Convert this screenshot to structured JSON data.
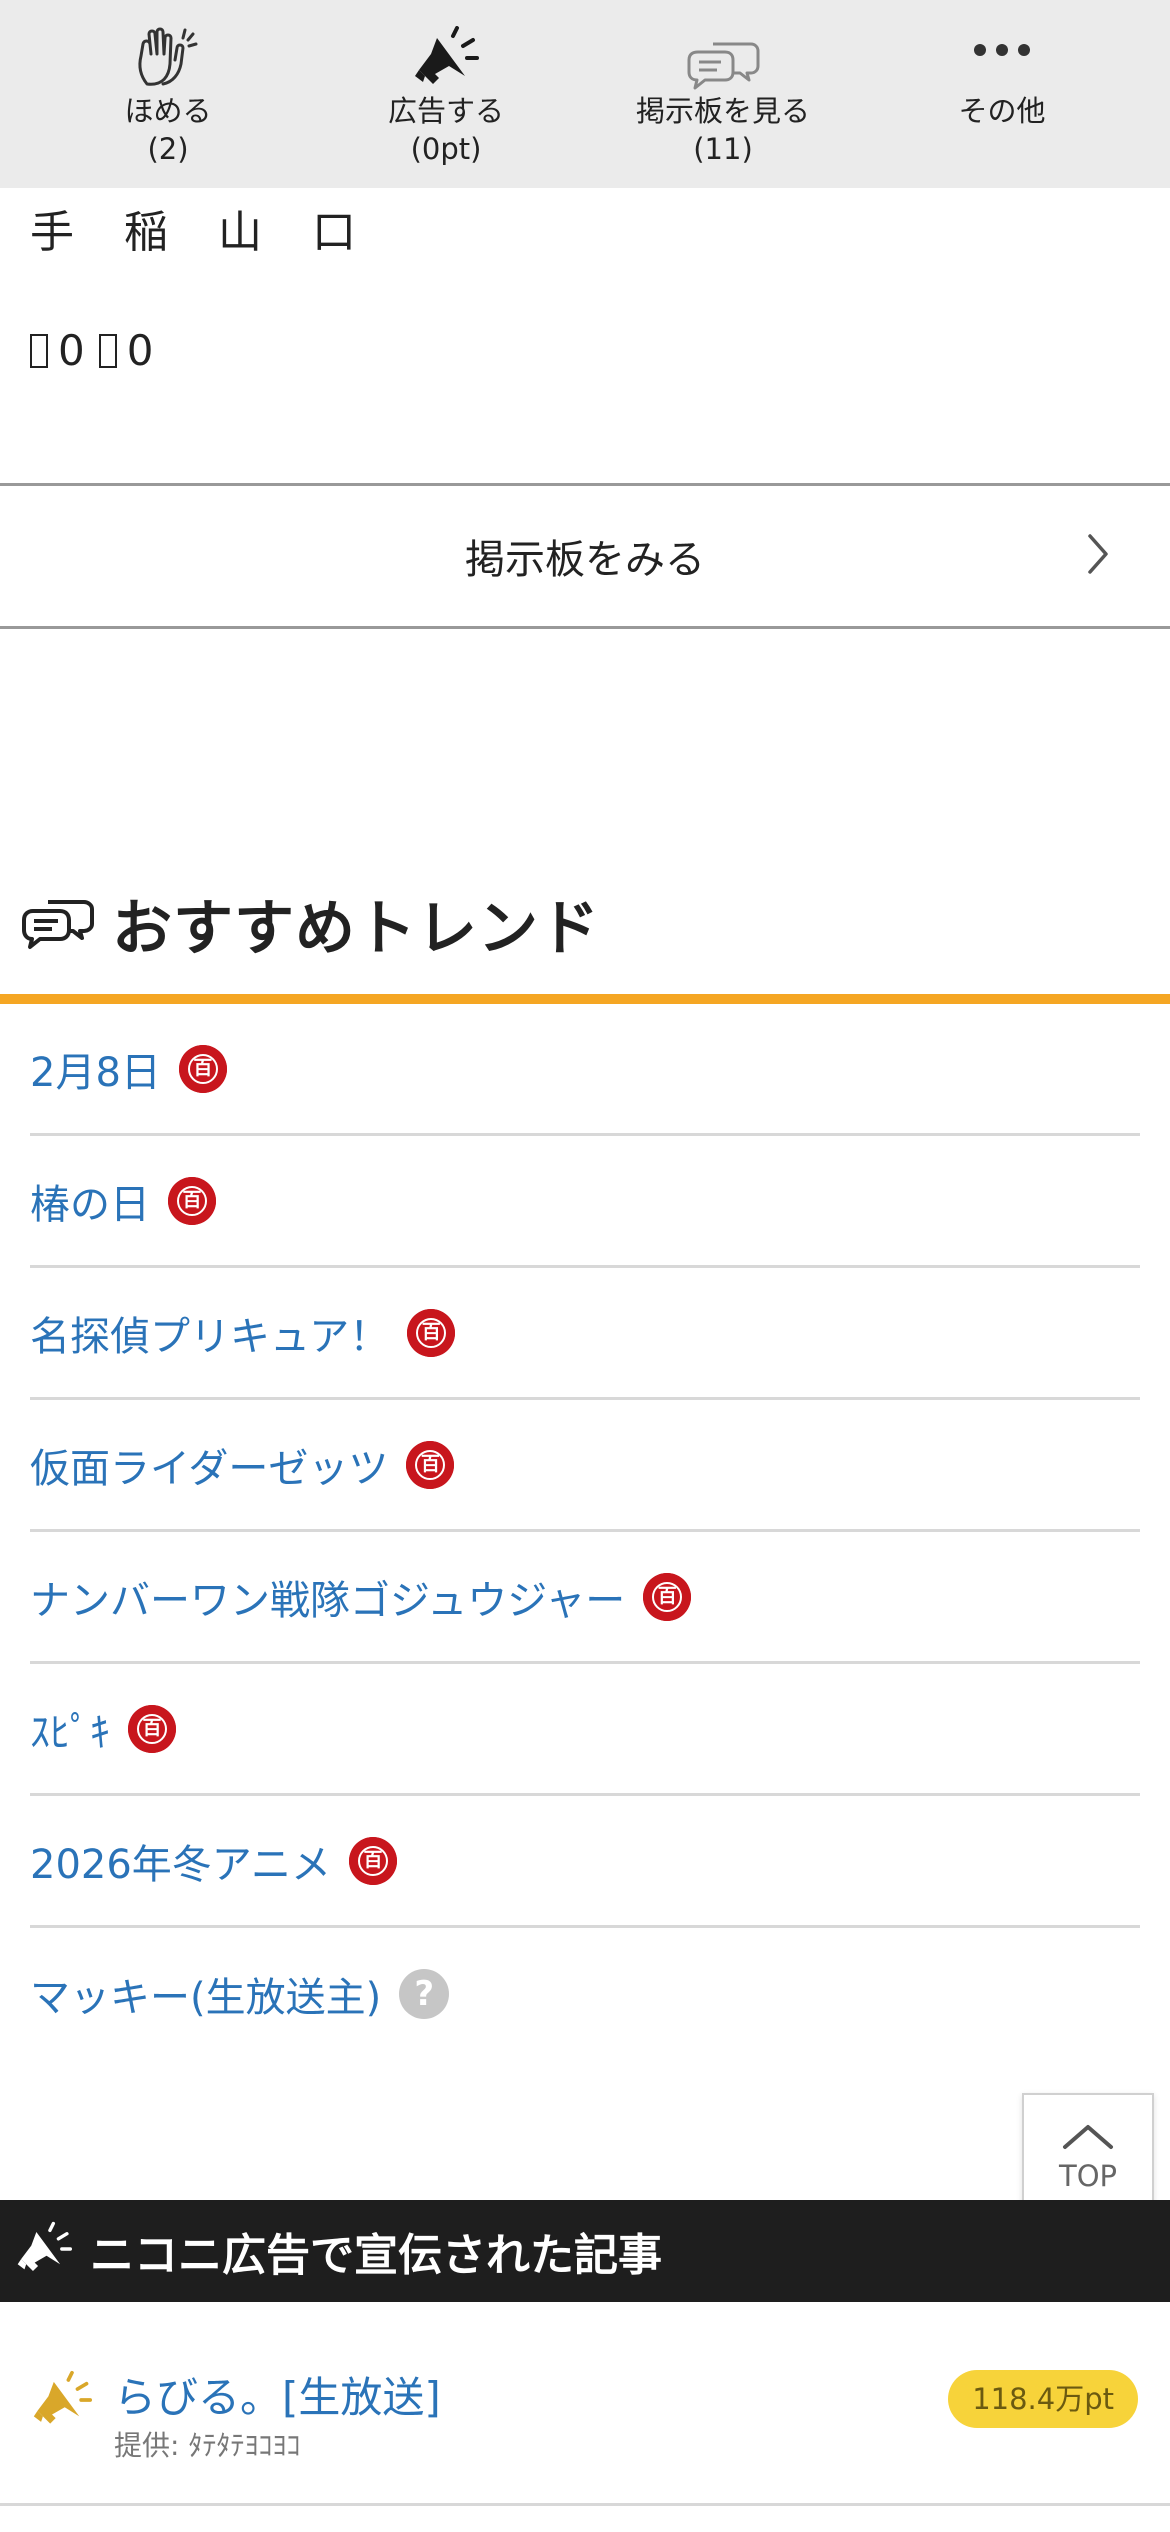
{
  "action_bar": {
    "items": [
      {
        "icon": "clap-icon",
        "label": "ほめる",
        "count": "(2)"
      },
      {
        "icon": "megaphone-icon",
        "label": "広告する",
        "count": "(0pt)"
      },
      {
        "icon": "chat-bubbles-icon",
        "label": "掲示板を見る",
        "count": "(11)"
      },
      {
        "icon": "more-dots-icon",
        "label": "その他",
        "count": ""
      }
    ]
  },
  "chars": [
    "手",
    "稲",
    "山",
    "口"
  ],
  "counts": {
    "first": "0",
    "second": "0"
  },
  "board_link": {
    "label": "掲示板をみる"
  },
  "trend": {
    "title": "おすすめトレンド",
    "items": [
      {
        "label": "2月8日",
        "badge": "dic"
      },
      {
        "label": "椿の日",
        "badge": "dic"
      },
      {
        "label": "名探偵プリキュア！",
        "badge": "dic"
      },
      {
        "label": "仮面ライダーゼッツ",
        "badge": "dic"
      },
      {
        "label": "ナンバーワン戦隊ゴジュウジャー",
        "badge": "dic"
      },
      {
        "label": "ｽﾋﾟｷ",
        "badge": "dic"
      },
      {
        "label": "2026年冬アニメ",
        "badge": "dic"
      },
      {
        "label": "マッキー(生放送主)",
        "badge": "question"
      }
    ],
    "badge_glyph": "百",
    "question_glyph": "?"
  },
  "top_button": {
    "label": "TOP"
  },
  "ad_section": {
    "title": "ニコニ広告で宣伝された記事",
    "items": [
      {
        "name": "らびる。[生放送]",
        "provider": "提供: ﾀﾃﾀﾃﾖｺﾖｺ",
        "points": "118.4万pt"
      }
    ]
  },
  "colors": {
    "link": "#2a73b8",
    "accent_orange": "#f5a623",
    "dic_red": "#c8161d",
    "points_yellow": "#f7d33a",
    "ad_header_bg": "#1e1e1e"
  }
}
